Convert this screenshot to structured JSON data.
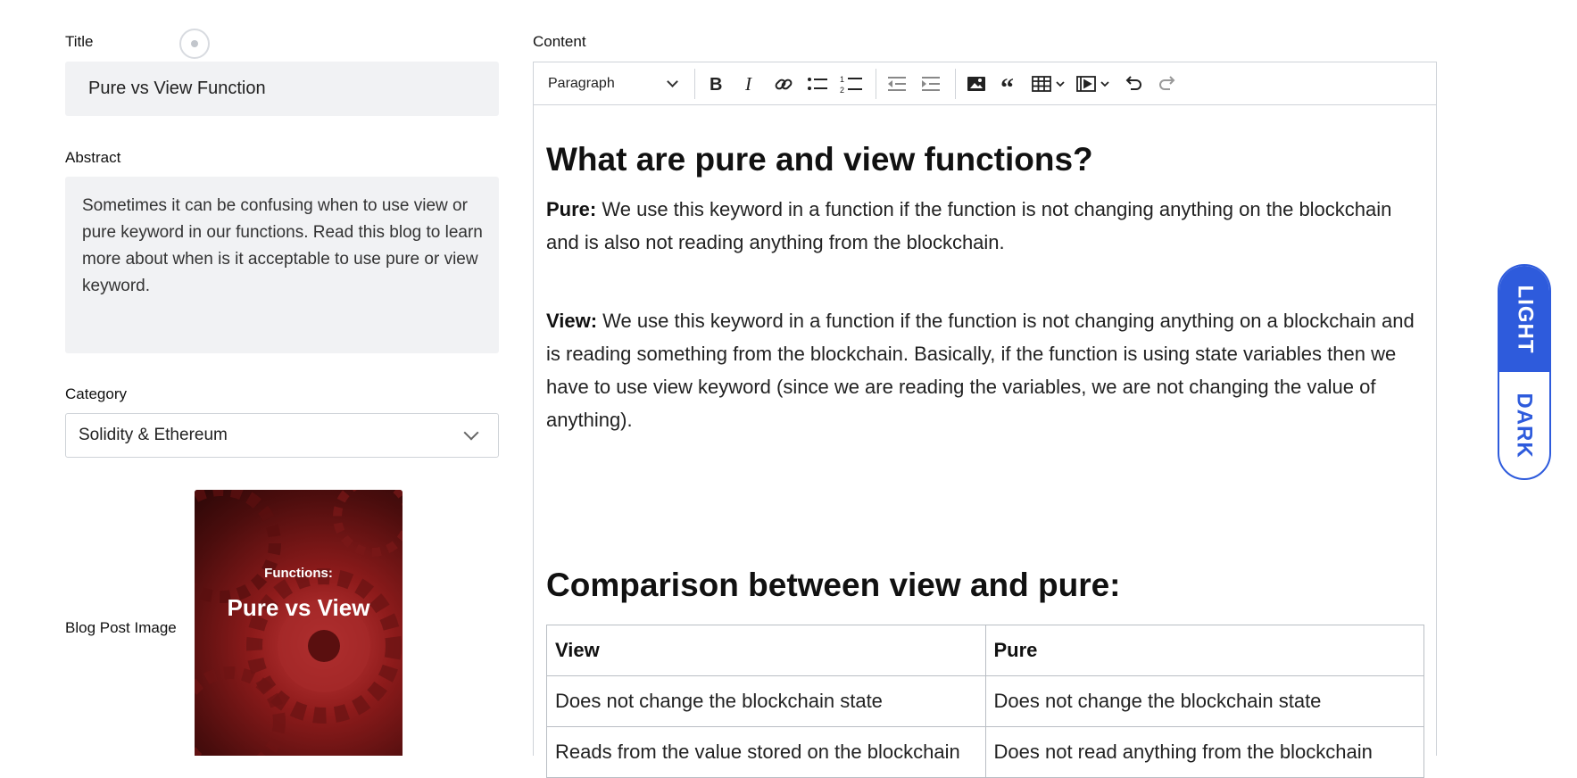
{
  "form": {
    "title_label": "Title",
    "title_value": "Pure vs View Function",
    "abstract_label": "Abstract",
    "abstract_value": "Sometimes it can be confusing when to use view or pure keyword in our functions. Read this blog to learn more about when is it acceptable to use pure or view keyword.",
    "category_label": "Category",
    "category_value": "Solidity & Ethereum",
    "image_label": "Blog Post Image",
    "image_subtitle": "Functions:",
    "image_title": "Pure vs View"
  },
  "editor": {
    "content_label": "Content",
    "toolbar": {
      "heading_select": "Paragraph",
      "icons": [
        "bold-icon",
        "italic-icon",
        "link-icon",
        "bulleted-list-icon",
        "numbered-list-icon",
        "outdent-icon",
        "indent-icon",
        "image-icon",
        "quote-icon",
        "table-icon",
        "media-icon",
        "undo-icon",
        "redo-icon"
      ]
    },
    "body": {
      "heading1": "What are pure and view functions?",
      "pure_term": "Pure:",
      "pure_text": " We use this keyword in a function if the function is not changing anything on the blockchain and is also not reading anything from the blockchain.",
      "view_term": "View:",
      "view_text": " We use this keyword in a function if the function is not changing anything on a blockchain and is reading something from the blockchain. Basically, if the function is using state variables then we have to use view keyword (since we are reading the variables, we are not changing the value of anything).",
      "heading2": "Comparison between view and pure:",
      "table": {
        "headers": [
          "View",
          "Pure"
        ],
        "rows": [
          [
            "Does not change the blockchain state",
            "Does not change the blockchain state"
          ],
          [
            "Reads from the value stored on the blockchain",
            "Does not read anything from the blockchain"
          ]
        ]
      }
    }
  },
  "theme_toggle": {
    "light_label": "LIGHT",
    "dark_label": "DARK",
    "active": "LIGHT",
    "accent": "#2e5bdc"
  }
}
